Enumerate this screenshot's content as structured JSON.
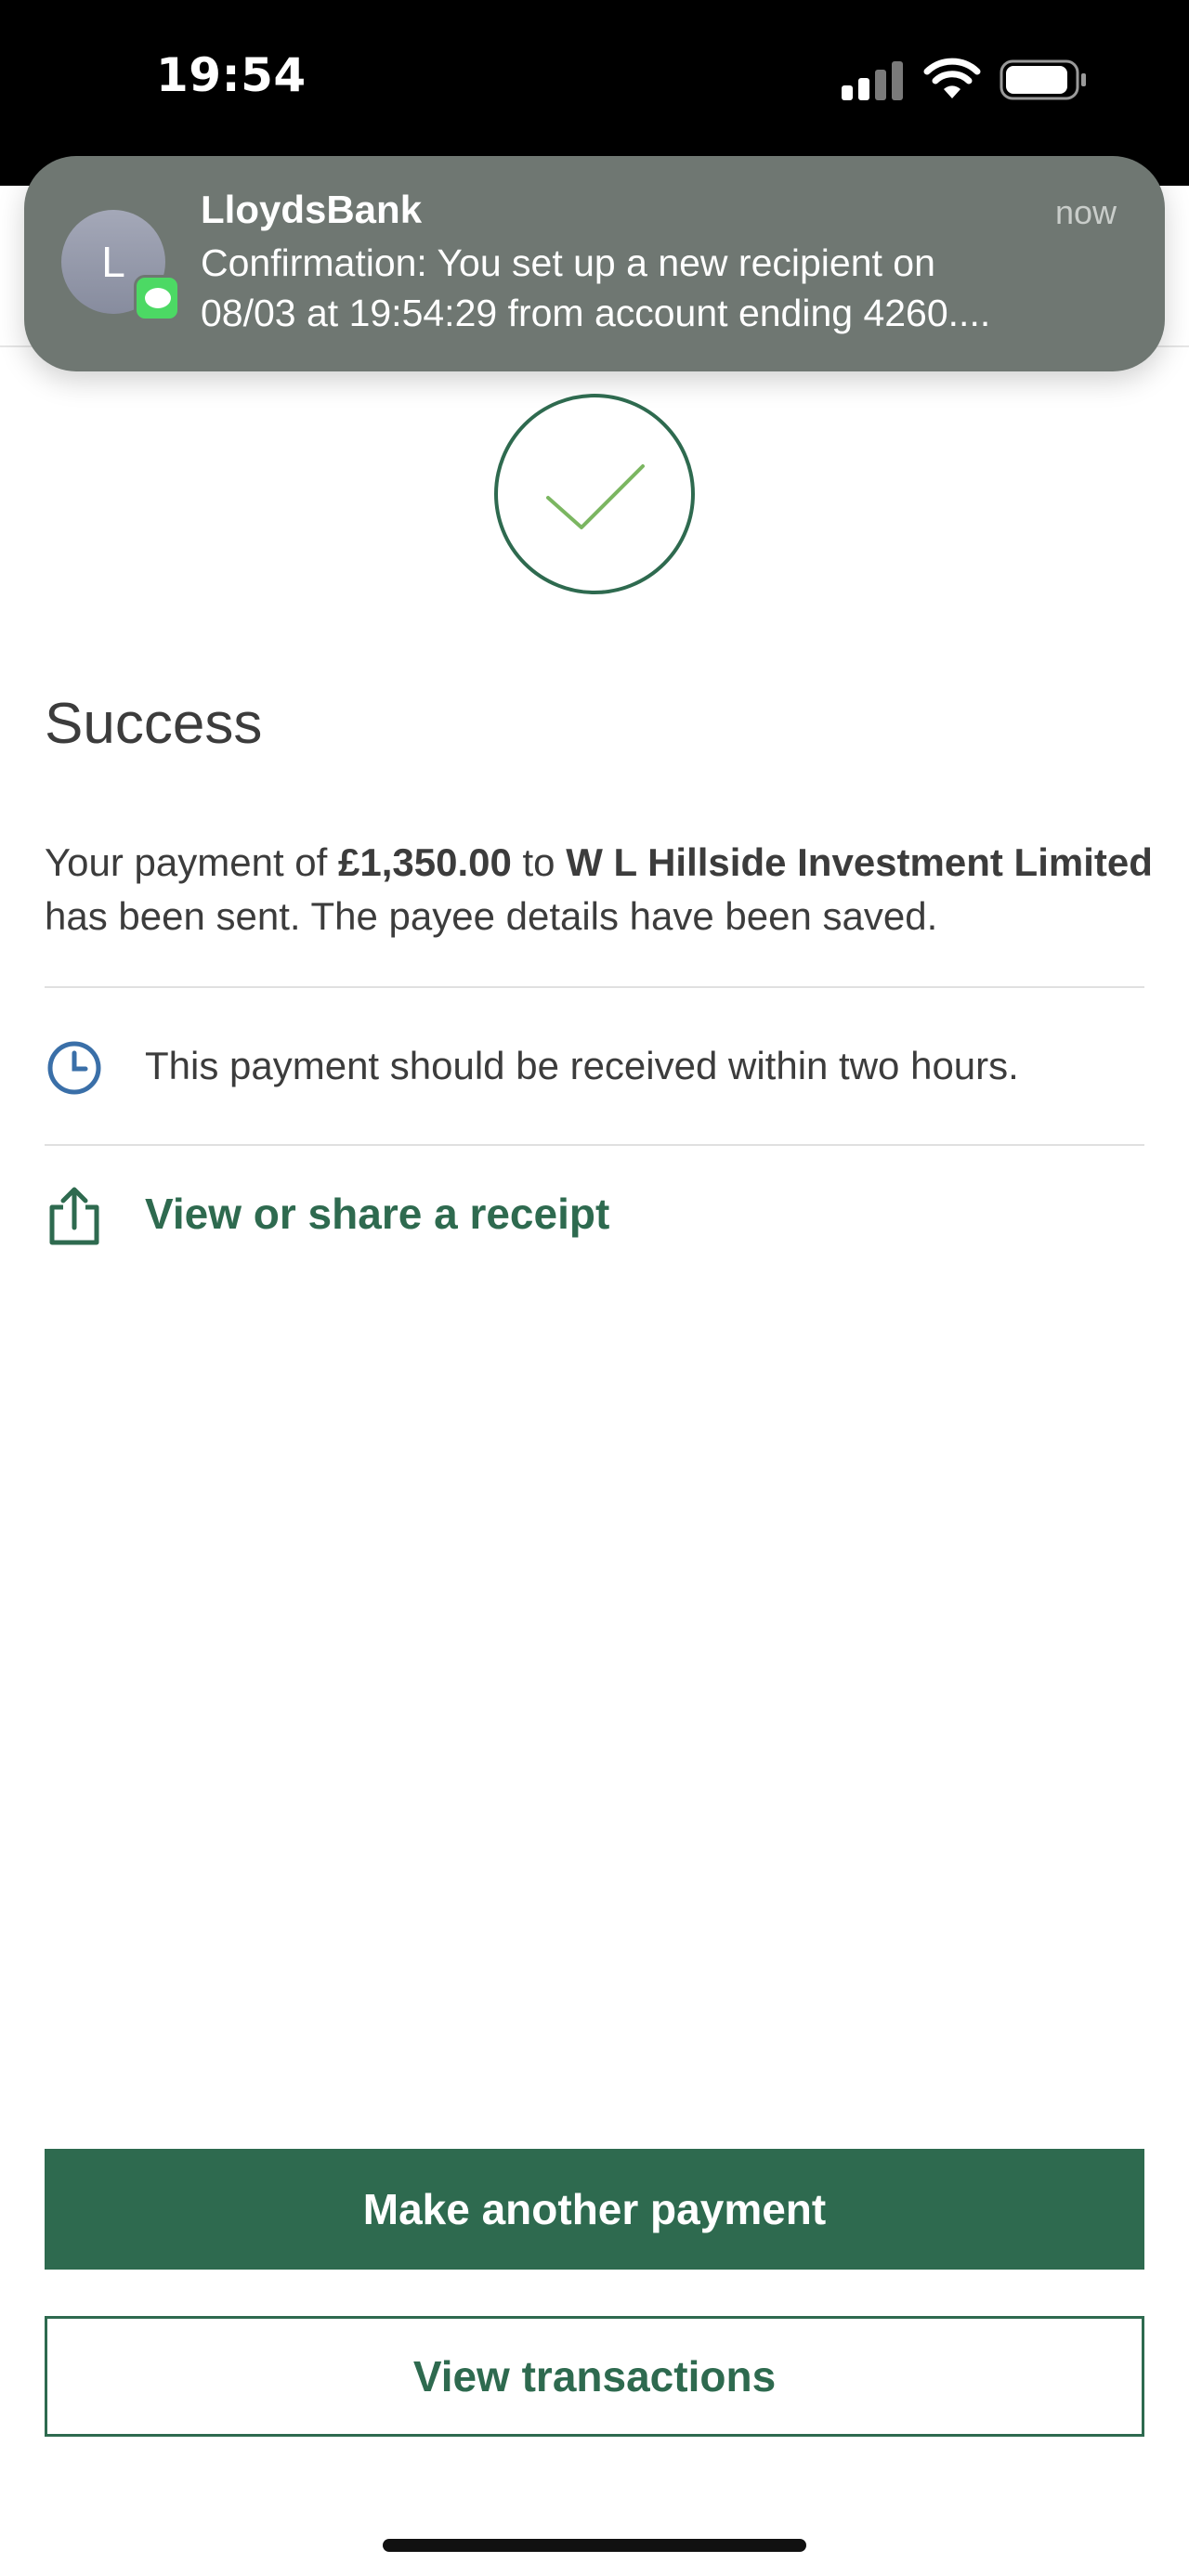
{
  "status_bar": {
    "time": "19:54",
    "icons": [
      "cellular-signal-icon",
      "wifi-icon",
      "battery-icon"
    ]
  },
  "notification": {
    "avatar_letter": "L",
    "app_name": "LloydsBank",
    "time": "now",
    "message_line1": "Confirmation: You set up a new recipient on",
    "message_line2": "08/03 at 19:54:29 from account ending 4260....",
    "badge_icon": "messages-icon"
  },
  "main": {
    "title": "Success",
    "payment_prefix": "Your payment of ",
    "amount": "£1,350.00",
    "payment_mid": " to ",
    "payee": "W L Hillside Investment Limited",
    "payment_suffix": " has been sent. The payee details have been saved.",
    "timing_text": "This payment should be received within two hours.",
    "receipt_link": "View or share a receipt"
  },
  "buttons": {
    "make_another_payment": "Make another payment",
    "view_transactions": "View transactions"
  },
  "colors": {
    "brand_green": "#2e6a4f",
    "check_green": "#7bb661",
    "clock_blue": "#3a6fa8",
    "notification_bg": "#6f7772"
  }
}
